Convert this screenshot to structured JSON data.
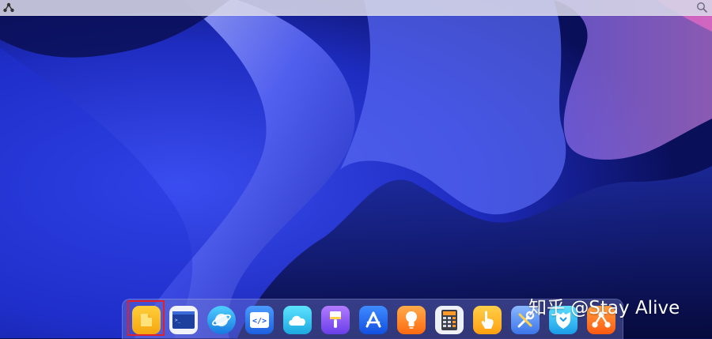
{
  "menubar": {
    "launcher_icon": "deepin-launcher-icon",
    "search_icon": "search-icon"
  },
  "dock": {
    "items": [
      {
        "name": "file-manager",
        "icon": "folder-icon",
        "color": "#f7b81c",
        "selected": true
      },
      {
        "name": "terminal",
        "icon": "terminal-icon",
        "color": "#1e4fb5"
      },
      {
        "name": "browser",
        "icon": "planet-icon",
        "color": "#1a8fe8"
      },
      {
        "name": "code-editor",
        "icon": "code-icon",
        "color": "#2d7cf3"
      },
      {
        "name": "cloud-sync",
        "icon": "cloud-icon",
        "color": "#27c0e8"
      },
      {
        "name": "draw",
        "icon": "paint-brush-icon",
        "color": "#8b5cf0"
      },
      {
        "name": "app-store",
        "icon": "app-store-icon",
        "color": "#1d6cf0"
      },
      {
        "name": "tips",
        "icon": "lightbulb-icon",
        "color": "#ff8a1c"
      },
      {
        "name": "calculator",
        "icon": "calculator-icon",
        "color": "#e9ecf2"
      },
      {
        "name": "touch-tool",
        "icon": "hand-pointer-icon",
        "color": "#ffb21c"
      },
      {
        "name": "system-tools",
        "icon": "tools-icon",
        "color": "#4a8af0"
      },
      {
        "name": "security-center",
        "icon": "shield-icon",
        "color": "#27b8f0"
      },
      {
        "name": "share",
        "icon": "share-nodes-icon",
        "color": "#ff7a18"
      }
    ]
  },
  "watermark": {
    "text": "知乎 @Stay Alive"
  },
  "colors": {
    "selection_frame": "#e0202a"
  }
}
